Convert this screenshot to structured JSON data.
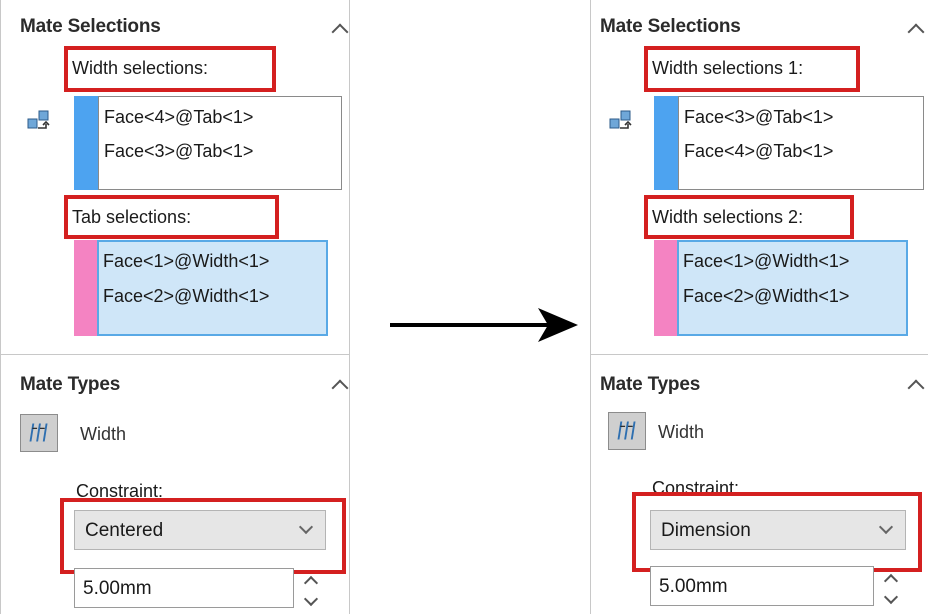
{
  "before": {
    "mate_selections": {
      "title": "Mate Selections",
      "group1_label": "Width selections:",
      "group1_items": [
        "Face<4>@Tab<1>",
        "Face<3>@Tab<1>"
      ],
      "group2_label": "Tab selections:",
      "group2_items": [
        "Face<1>@Width<1>",
        "Face<2>@Width<1>"
      ]
    },
    "mate_types": {
      "title": "Mate Types",
      "type_label": "Width",
      "constraint_label": "Constraint:",
      "constraint_value": "Centered",
      "dimension_value": "5.00mm"
    }
  },
  "after": {
    "mate_selections": {
      "title": "Mate Selections",
      "group1_label": "Width selections 1:",
      "group1_items": [
        "Face<3>@Tab<1>",
        "Face<4>@Tab<1>"
      ],
      "group2_label": "Width selections 2:",
      "group2_items": [
        "Face<1>@Width<1>",
        "Face<2>@Width<1>"
      ]
    },
    "mate_types": {
      "title": "Mate Types",
      "type_label": "Width",
      "constraint_label": "Constraint:",
      "constraint_value": "Dimension",
      "dimension_value": "5.00mm"
    }
  },
  "colors": {
    "highlight_box": "#d42020",
    "selection_blue": "#4da3f0",
    "selection_pink": "#f483c2",
    "active_list_bg": "#cfe6f8"
  },
  "icons": [
    "mate-swap-icon",
    "width-mate-icon",
    "collapse-chevron-icon",
    "dropdown-chevron-icon",
    "spin-arrows-icon",
    "transition-arrow-icon"
  ]
}
